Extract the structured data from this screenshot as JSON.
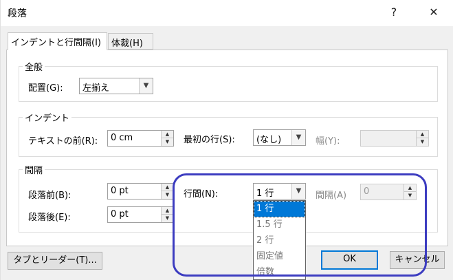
{
  "dialog": {
    "title": "段落",
    "help_label": "?",
    "close_label": "✕"
  },
  "tabs": [
    {
      "label": "インデントと行間隔(I)"
    },
    {
      "label": "体裁(H)"
    }
  ],
  "general": {
    "title": "全般",
    "alignment_label": "配置(G):",
    "alignment_value": "左揃え"
  },
  "indent": {
    "title": "インデント",
    "before_text_label": "テキストの前(R):",
    "before_text_value": "0 cm",
    "first_line_label": "最初の行(S):",
    "first_line_value": "(なし)",
    "by_label": "幅(Y):",
    "by_value": ""
  },
  "spacing": {
    "title": "間隔",
    "before_label": "段落前(B):",
    "before_value": "0 pt",
    "after_label": "段落後(E):",
    "after_value": "0 pt",
    "line_spacing_label": "行間(N):",
    "line_spacing_value": "1 行",
    "at_label": "間隔(A)",
    "at_value": "0"
  },
  "line_spacing_options": [
    "1 行",
    "1.5 行",
    "2 行",
    "固定値",
    "倍数"
  ],
  "buttons": {
    "tabs_leaders": "タブとリーダー(T)...",
    "ok": "OK",
    "cancel": "キャンセル"
  },
  "colors": {
    "selection": "#0078d7",
    "highlight_ring": "#3c3cc0"
  }
}
